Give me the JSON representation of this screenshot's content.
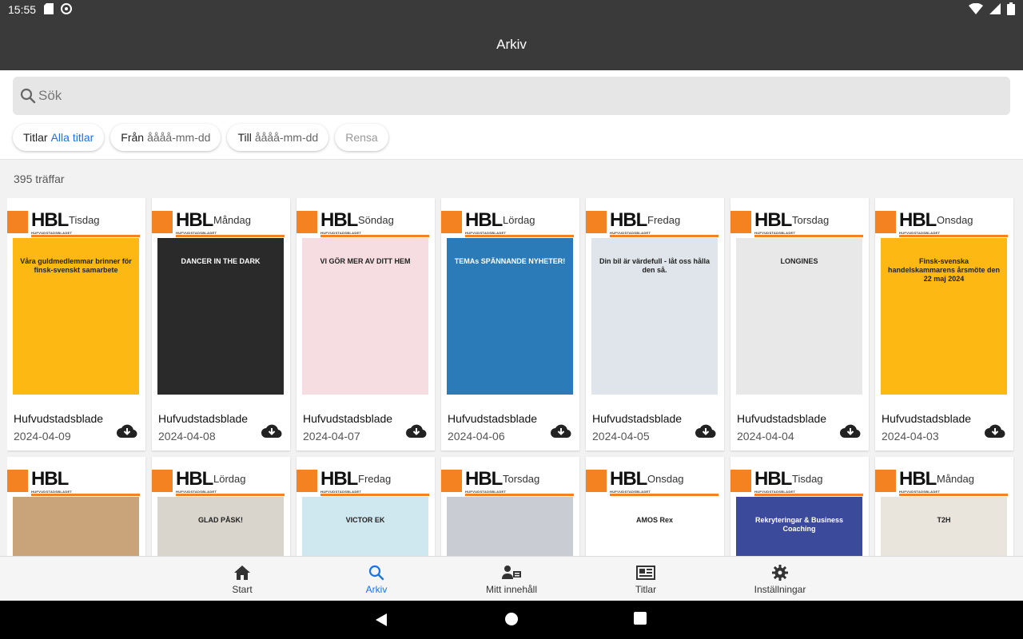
{
  "status": {
    "time": "15:55"
  },
  "appbar": {
    "title": "Arkiv"
  },
  "search": {
    "placeholder": "Sök"
  },
  "chips": [
    {
      "label": "Titlar",
      "value": "Alla titlar"
    },
    {
      "label": "Från",
      "value": "åååå-mm-dd"
    },
    {
      "label": "Till",
      "value": "åååå-mm-dd"
    },
    {
      "label": "Rensa"
    }
  ],
  "results": {
    "count_text": "395 träffar"
  },
  "masthead": {
    "logo": "HBL",
    "subtitle": "HUFVUDSTADSBLADET"
  },
  "cards": [
    {
      "day": "Tisdag",
      "title": "Hufvudstadsblade",
      "date": "2024-04-09",
      "art_color": "#fdb813",
      "headline": "Våra guldmedlemmar brinner för finsk-svenskt samarbete"
    },
    {
      "day": "Måndag",
      "title": "Hufvudstadsblade",
      "date": "2024-04-08",
      "art_color": "#2a2a2a",
      "headline": "DANCER IN THE DARK"
    },
    {
      "day": "Söndag",
      "title": "Hufvudstadsblade",
      "date": "2024-04-07",
      "art_color": "#f6dde2",
      "headline": "VI GÖR MER AV DITT HEM"
    },
    {
      "day": "Lördag",
      "title": "Hufvudstadsblade",
      "date": "2024-04-06",
      "art_color": "#2b7bb9",
      "headline": "TEMAs SPÄNNANDE NYHETER!"
    },
    {
      "day": "Fredag",
      "title": "Hufvudstadsblade",
      "date": "2024-04-05",
      "art_color": "#dfe5ea",
      "headline": "Din bil är värdefull - låt oss hålla den så."
    },
    {
      "day": "Torsdag",
      "title": "Hufvudstadsblade",
      "date": "2024-04-04",
      "art_color": "#e8e8e8",
      "headline": "LONGINES"
    },
    {
      "day": "Onsdag",
      "title": "Hufvudstadsblade",
      "date": "2024-04-03",
      "art_color": "#fdb813",
      "headline": "Finsk-svenska handelskammarens årsmöte den 22 maj 2024"
    }
  ],
  "cards_row2": [
    {
      "day": "",
      "art_color": "#c9a37a",
      "headline": ""
    },
    {
      "day": "Lördag",
      "art_color": "#d9d4cc",
      "headline": "GLAD PÅSK!"
    },
    {
      "day": "Fredag",
      "art_color": "#cfe8ef",
      "headline": "VICTOR EK"
    },
    {
      "day": "Torsdag",
      "art_color": "#c9cdd3",
      "headline": ""
    },
    {
      "day": "Onsdag",
      "art_color": "#ffffff",
      "headline": "AMOS Rex"
    },
    {
      "day": "Tisdag",
      "art_color": "#3b4a9a",
      "headline": "Rekryteringar & Business Coaching"
    },
    {
      "day": "Måndag",
      "art_color": "#e9e4dc",
      "headline": "T2H"
    }
  ],
  "nav": [
    {
      "label": "Start",
      "icon": "home-icon"
    },
    {
      "label": "Arkiv",
      "icon": "search-icon"
    },
    {
      "label": "Mitt innehåll",
      "icon": "person-content-icon"
    },
    {
      "label": "Titlar",
      "icon": "newspaper-icon"
    },
    {
      "label": "Inställningar",
      "icon": "gear-icon"
    }
  ],
  "colors": {
    "accent": "#1a73e8",
    "brand_orange": "#f58220",
    "bar": "#3a3a3a"
  }
}
